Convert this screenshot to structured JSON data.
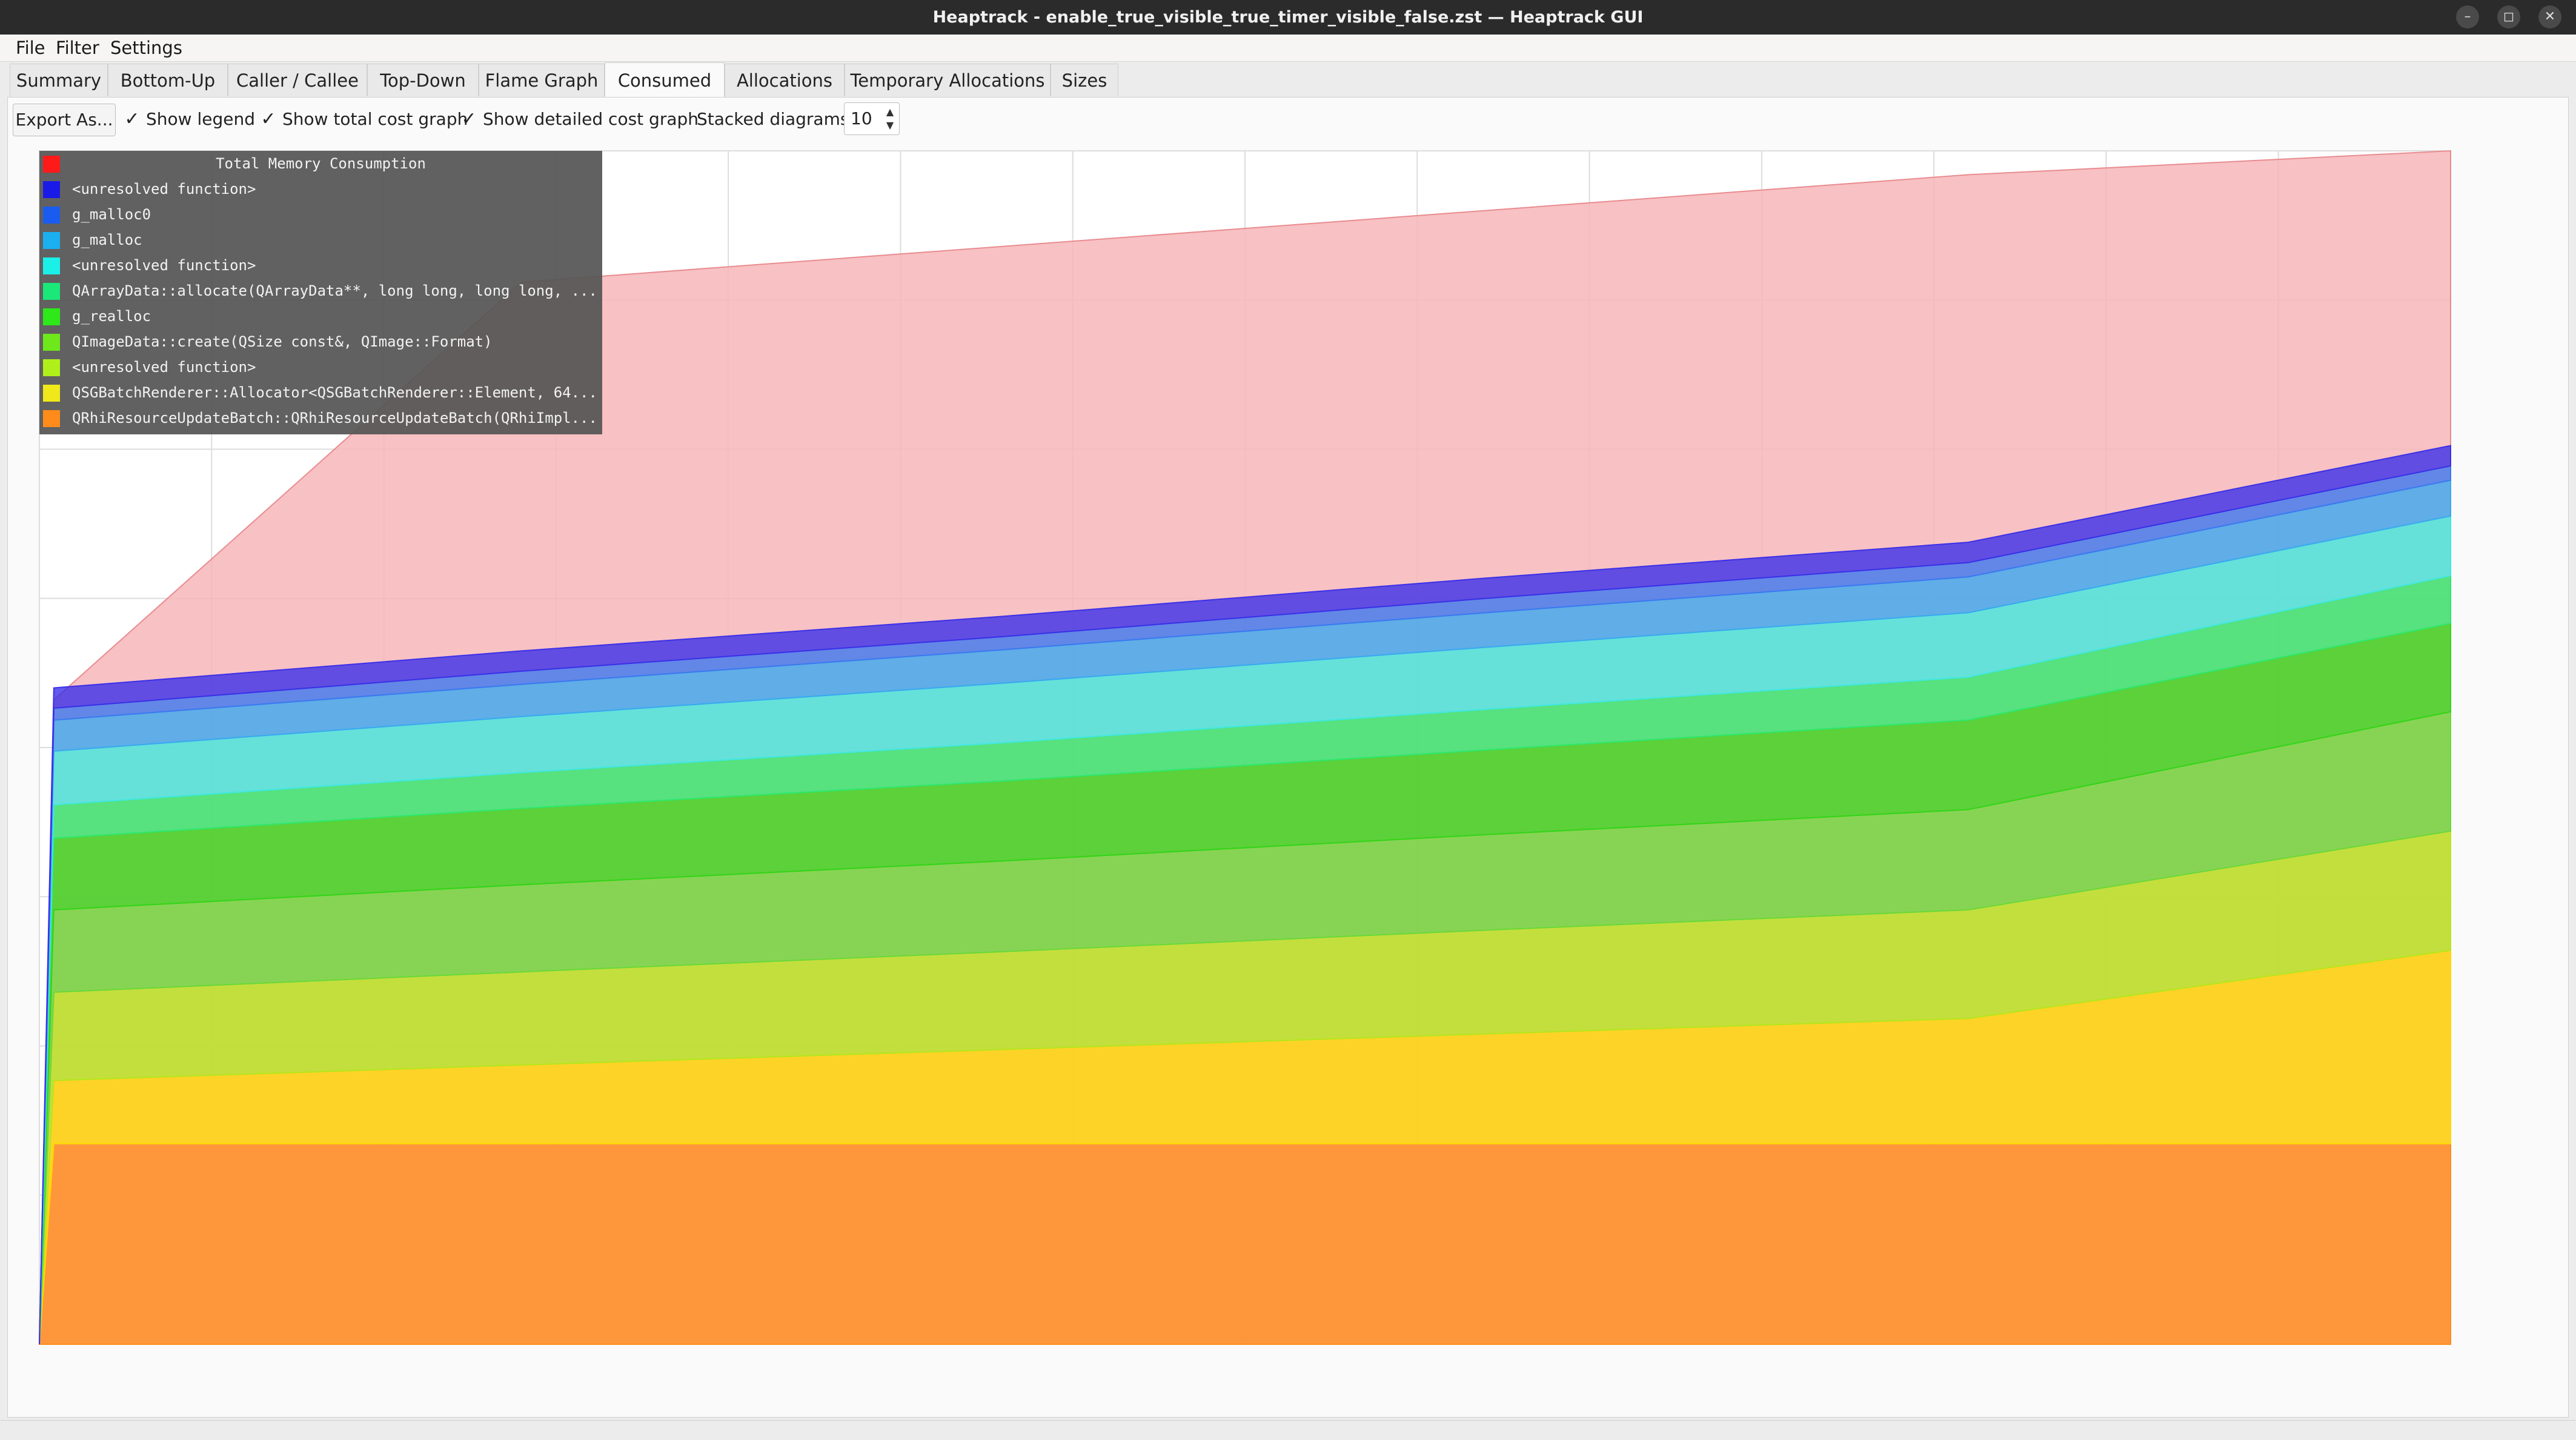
{
  "window": {
    "title": "Heaptrack - enable_true_visible_true_timer_visible_false.zst — Heaptrack GUI",
    "buttons": {
      "minimize": "–",
      "restore": "◻",
      "close": "✕"
    }
  },
  "menu": {
    "file": "File",
    "filter": "Filter",
    "settings": "Settings"
  },
  "tabs": [
    "Summary",
    "Bottom-Up",
    "Caller / Callee",
    "Top-Down",
    "Flame Graph",
    "Consumed",
    "Allocations",
    "Temporary Allocations",
    "Sizes"
  ],
  "active_tab": "Consumed",
  "toolbar": {
    "export_label": "Export As...",
    "show_legend": "Show legend",
    "show_total": "Show total cost graph",
    "show_detailed": "Show detailed cost graph",
    "stacked_label": "Stacked diagrams:",
    "stacked_value": "10",
    "checked_glyph": "✓",
    "spin_up": "▲",
    "spin_down": "▼"
  },
  "chart_data": {
    "type": "area",
    "stacked": true,
    "x": [
      0,
      0.006,
      0.2,
      0.4,
      0.6,
      0.8,
      1.0
    ],
    "legend": {
      "title": "Total Memory Consumption",
      "placement": "top-left"
    },
    "grid": true,
    "total": {
      "name": "Total Memory Consumption",
      "color": "#f7b6b8",
      "values": [
        0,
        0.54,
        0.89,
        0.92,
        0.95,
        0.98,
        1.0
      ]
    },
    "series": [
      {
        "name": "QRhiResourceUpdateBatch::QRhiResourceUpdateBatch(QRhiImpl...",
        "color": "#ff8c1a",
        "values": [
          0,
          0.168,
          0.168,
          0.168,
          0.168,
          0.168,
          0.168
        ]
      },
      {
        "name": "QSGBatchRenderer::Allocator<QSGBatchRenderer::Element, 64...",
        "color": "#ffd700",
        "values": [
          0,
          0.053,
          0.066,
          0.079,
          0.092,
          0.105,
          0.162
        ]
      },
      {
        "name": "<unresolved function>",
        "color": "#b5e61d",
        "values": [
          0,
          0.074,
          0.078,
          0.082,
          0.087,
          0.091,
          0.1
        ]
      },
      {
        "name": "QImageData::create(QSize const&, QImage::Format)",
        "color": "#6ad83a",
        "values": [
          0,
          0.069,
          0.073,
          0.076,
          0.08,
          0.084,
          0.1
        ]
      },
      {
        "name": "g_realloc",
        "color": "#34d418",
        "values": [
          0,
          0.06,
          0.064,
          0.067,
          0.071,
          0.075,
          0.074
        ]
      },
      {
        "name": "QArrayData::allocate(QArrayData**, long long, long long, ...",
        "color": "#2ee86e",
        "values": [
          0,
          0.028,
          0.03,
          0.032,
          0.034,
          0.036,
          0.04
        ]
      },
      {
        "name": "<unresolved function>",
        "color": "#40e8e0",
        "values": [
          0,
          0.045,
          0.047,
          0.05,
          0.052,
          0.054,
          0.05
        ]
      },
      {
        "name": "g_malloc",
        "color": "#3aa8f0",
        "values": [
          0,
          0.026,
          0.027,
          0.028,
          0.029,
          0.03,
          0.03
        ]
      },
      {
        "name": "g_malloc0",
        "color": "#3c78f0",
        "values": [
          0,
          0.01,
          0.011,
          0.011,
          0.012,
          0.012,
          0.012
        ]
      },
      {
        "name": "<unresolved function>",
        "color": "#3b30e8",
        "values": [
          0,
          0.017,
          0.017,
          0.017,
          0.017,
          0.017,
          0.017
        ]
      }
    ]
  }
}
